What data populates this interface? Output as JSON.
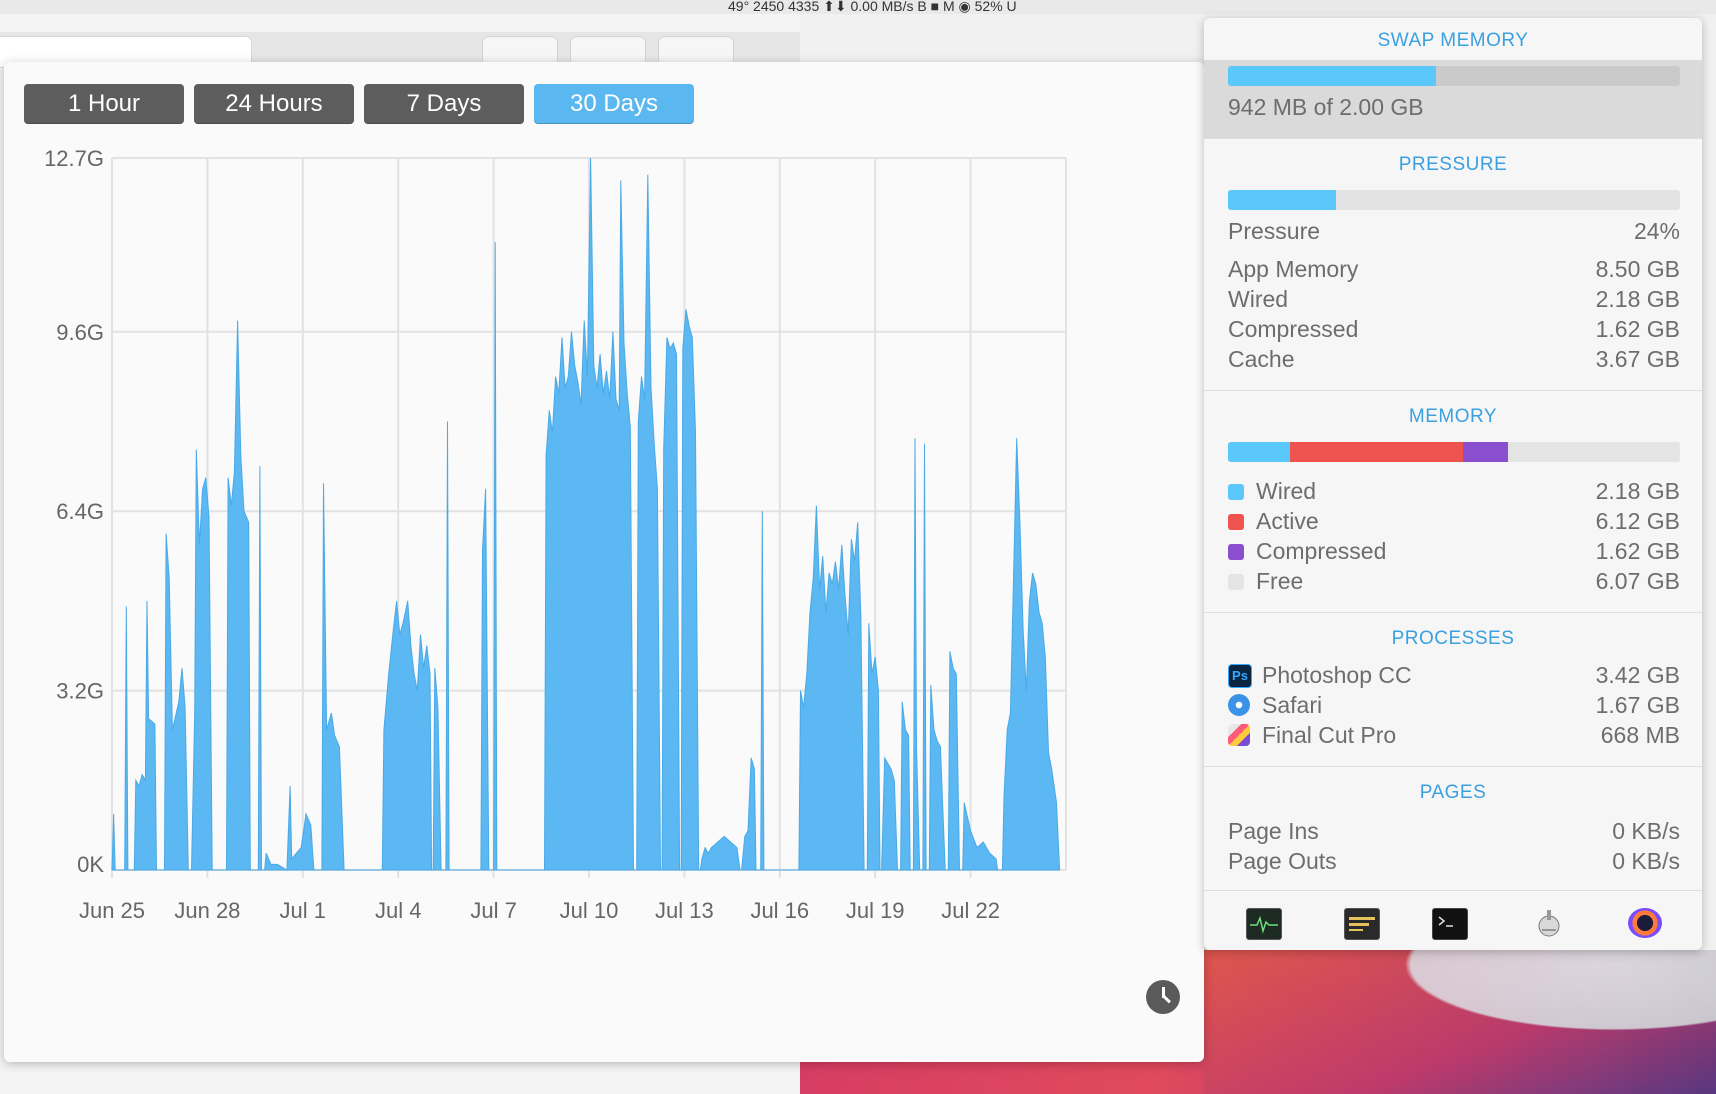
{
  "menubar": {
    "text": "49° 2450 4335 ⬆⬇ 0.00 MB/s B ■ M ◉ 52% U"
  },
  "range_buttons": [
    {
      "label": "1 Hour",
      "active": false
    },
    {
      "label": "24 Hours",
      "active": false
    },
    {
      "label": "7 Days",
      "active": false
    },
    {
      "label": "30 Days",
      "active": true
    }
  ],
  "chart_data": {
    "type": "area",
    "x_tick_labels": [
      "Jun 25",
      "Jun 28",
      "Jul 1",
      "Jul 4",
      "Jul 7",
      "Jul 10",
      "Jul 13",
      "Jul 16",
      "Jul 19",
      "Jul 22"
    ],
    "y_tick_labels": [
      "12.7G",
      "9.6G",
      "6.4G",
      "3.2G",
      "0K"
    ],
    "y_tick_values": [
      12.7,
      9.6,
      6.4,
      3.2,
      0
    ],
    "ylim": [
      0,
      12.7
    ],
    "x_unit": "days since Jun 25",
    "xlim": [
      0,
      30
    ],
    "grid": true,
    "color": "#5bb8f2",
    "series": [
      {
        "values": [
          [
            0.0,
            0
          ],
          [
            0.05,
            1.0
          ],
          [
            0.1,
            0
          ],
          [
            0.4,
            0
          ],
          [
            0.45,
            4.7
          ],
          [
            0.5,
            0
          ],
          [
            0.7,
            0
          ],
          [
            0.75,
            1.6
          ],
          [
            0.85,
            1.5
          ],
          [
            0.95,
            1.7
          ],
          [
            1.05,
            1.6
          ],
          [
            1.1,
            4.8
          ],
          [
            1.15,
            2.7
          ],
          [
            1.35,
            2.6
          ],
          [
            1.4,
            0
          ],
          [
            1.65,
            0
          ],
          [
            1.7,
            6.0
          ],
          [
            1.8,
            5.2
          ],
          [
            1.9,
            2.5
          ],
          [
            2.1,
            3.0
          ],
          [
            2.2,
            3.6
          ],
          [
            2.3,
            2.9
          ],
          [
            2.4,
            0
          ],
          [
            2.5,
            0
          ],
          [
            2.6,
            2.8
          ],
          [
            2.65,
            7.5
          ],
          [
            2.75,
            5.8
          ],
          [
            2.85,
            6.8
          ],
          [
            2.95,
            7.0
          ],
          [
            3.05,
            6.3
          ],
          [
            3.15,
            0
          ],
          [
            3.6,
            0
          ],
          [
            3.65,
            7.0
          ],
          [
            3.75,
            6.5
          ],
          [
            3.85,
            7.1
          ],
          [
            3.95,
            9.8
          ],
          [
            4.05,
            7.4
          ],
          [
            4.15,
            6.4
          ],
          [
            4.3,
            6.2
          ],
          [
            4.35,
            0
          ],
          [
            4.6,
            0
          ],
          [
            4.65,
            7.2
          ],
          [
            4.7,
            0
          ],
          [
            4.8,
            0
          ],
          [
            4.85,
            0.3
          ],
          [
            5.0,
            0.1
          ],
          [
            5.2,
            0.1
          ],
          [
            5.5,
            0
          ],
          [
            5.6,
            1.5
          ],
          [
            5.65,
            0.2
          ],
          [
            5.8,
            0.3
          ],
          [
            5.95,
            0.4
          ],
          [
            6.1,
            1.0
          ],
          [
            6.25,
            0.8
          ],
          [
            6.35,
            0
          ],
          [
            6.6,
            0
          ],
          [
            6.65,
            6.9
          ],
          [
            6.75,
            2.5
          ],
          [
            6.9,
            2.8
          ],
          [
            7.0,
            2.4
          ],
          [
            7.15,
            2.2
          ],
          [
            7.3,
            0
          ],
          [
            8.5,
            0
          ],
          [
            8.55,
            2.5
          ],
          [
            8.7,
            3.5
          ],
          [
            8.85,
            4.3
          ],
          [
            8.95,
            4.8
          ],
          [
            9.05,
            4.2
          ],
          [
            9.15,
            4.4
          ],
          [
            9.3,
            4.8
          ],
          [
            9.4,
            4.0
          ],
          [
            9.5,
            3.5
          ],
          [
            9.6,
            3.2
          ],
          [
            9.7,
            4.2
          ],
          [
            9.8,
            3.6
          ],
          [
            9.9,
            4.0
          ],
          [
            10.0,
            3.5
          ],
          [
            10.05,
            0
          ],
          [
            10.1,
            0
          ],
          [
            10.15,
            3.6
          ],
          [
            10.25,
            2.9
          ],
          [
            10.35,
            0
          ],
          [
            10.5,
            0
          ],
          [
            10.55,
            8.0
          ],
          [
            10.6,
            0
          ],
          [
            11.6,
            0
          ],
          [
            11.65,
            5.7
          ],
          [
            11.75,
            6.8
          ],
          [
            11.85,
            0
          ],
          [
            12.0,
            0
          ],
          [
            12.05,
            11.2
          ],
          [
            12.1,
            0
          ],
          [
            13.6,
            0
          ],
          [
            13.65,
            7.4
          ],
          [
            13.75,
            8.2
          ],
          [
            13.85,
            7.8
          ],
          [
            13.95,
            8.8
          ],
          [
            14.05,
            8.5
          ],
          [
            14.15,
            9.5
          ],
          [
            14.25,
            8.6
          ],
          [
            14.35,
            8.8
          ],
          [
            14.45,
            9.6
          ],
          [
            14.55,
            9.0
          ],
          [
            14.65,
            8.7
          ],
          [
            14.75,
            8.3
          ],
          [
            14.85,
            9.8
          ],
          [
            14.95,
            8.8
          ],
          [
            15.05,
            12.7
          ],
          [
            15.15,
            9.0
          ],
          [
            15.25,
            8.6
          ],
          [
            15.35,
            9.2
          ],
          [
            15.45,
            8.5
          ],
          [
            15.55,
            8.9
          ],
          [
            15.65,
            8.4
          ],
          [
            15.75,
            9.6
          ],
          [
            15.85,
            8.4
          ],
          [
            15.95,
            8.2
          ],
          [
            16.0,
            12.3
          ],
          [
            16.1,
            9.4
          ],
          [
            16.2,
            8.5
          ],
          [
            16.3,
            7.9
          ],
          [
            16.4,
            0
          ],
          [
            16.5,
            0
          ],
          [
            16.55,
            8.0
          ],
          [
            16.65,
            8.8
          ],
          [
            16.75,
            8.4
          ],
          [
            16.85,
            12.4
          ],
          [
            16.95,
            8.6
          ],
          [
            17.05,
            7.6
          ],
          [
            17.15,
            6.8
          ],
          [
            17.25,
            0
          ],
          [
            17.3,
            0
          ],
          [
            17.35,
            7.5
          ],
          [
            17.45,
            9.5
          ],
          [
            17.55,
            9.3
          ],
          [
            17.65,
            9.4
          ],
          [
            17.75,
            9.2
          ],
          [
            17.85,
            0
          ],
          [
            17.9,
            0
          ],
          [
            17.95,
            9.3
          ],
          [
            18.05,
            10.0
          ],
          [
            18.15,
            9.7
          ],
          [
            18.25,
            9.5
          ],
          [
            18.35,
            7.8
          ],
          [
            18.45,
            0
          ],
          [
            18.5,
            0
          ],
          [
            18.55,
            0.2
          ],
          [
            18.65,
            0.4
          ],
          [
            18.75,
            0.3
          ],
          [
            18.85,
            0.4
          ],
          [
            19.05,
            0.5
          ],
          [
            19.25,
            0.6
          ],
          [
            19.45,
            0.5
          ],
          [
            19.65,
            0.4
          ],
          [
            19.75,
            0
          ],
          [
            19.8,
            0
          ],
          [
            19.9,
            0.6
          ],
          [
            20.0,
            0.7
          ],
          [
            20.1,
            2.0
          ],
          [
            20.2,
            1.8
          ],
          [
            20.25,
            0
          ],
          [
            20.4,
            0
          ],
          [
            20.45,
            6.4
          ],
          [
            20.5,
            0
          ],
          [
            21.6,
            0
          ],
          [
            21.65,
            3.2
          ],
          [
            21.75,
            2.9
          ],
          [
            21.85,
            3.5
          ],
          [
            21.95,
            4.6
          ],
          [
            22.05,
            5.2
          ],
          [
            22.15,
            6.5
          ],
          [
            22.25,
            5.0
          ],
          [
            22.35,
            5.6
          ],
          [
            22.45,
            4.6
          ],
          [
            22.55,
            5.3
          ],
          [
            22.65,
            5.1
          ],
          [
            22.75,
            5.5
          ],
          [
            22.85,
            5.0
          ],
          [
            22.95,
            5.8
          ],
          [
            23.05,
            4.9
          ],
          [
            23.15,
            4.2
          ],
          [
            23.25,
            5.9
          ],
          [
            23.35,
            5.5
          ],
          [
            23.45,
            6.2
          ],
          [
            23.55,
            4.5
          ],
          [
            23.65,
            0
          ],
          [
            23.75,
            0
          ],
          [
            23.8,
            4.4
          ],
          [
            23.9,
            3.5
          ],
          [
            24.0,
            3.8
          ],
          [
            24.1,
            3.2
          ],
          [
            24.15,
            0
          ],
          [
            24.2,
            0
          ],
          [
            24.3,
            2.0
          ],
          [
            24.4,
            1.9
          ],
          [
            24.5,
            1.8
          ],
          [
            24.6,
            1.6
          ],
          [
            24.7,
            0
          ],
          [
            24.8,
            0
          ],
          [
            24.85,
            3.0
          ],
          [
            24.95,
            2.5
          ],
          [
            25.05,
            2.4
          ],
          [
            25.1,
            0
          ],
          [
            25.2,
            0
          ],
          [
            25.25,
            7.7
          ],
          [
            25.3,
            2.2
          ],
          [
            25.4,
            0
          ],
          [
            25.5,
            0
          ],
          [
            25.55,
            7.6
          ],
          [
            25.6,
            0
          ],
          [
            25.7,
            0
          ],
          [
            25.75,
            3.3
          ],
          [
            25.85,
            2.5
          ],
          [
            25.95,
            2.3
          ],
          [
            26.05,
            2.2
          ],
          [
            26.2,
            0
          ],
          [
            26.3,
            0
          ],
          [
            26.35,
            3.9
          ],
          [
            26.45,
            3.6
          ],
          [
            26.55,
            3.5
          ],
          [
            26.65,
            0
          ],
          [
            26.75,
            0
          ],
          [
            26.8,
            1.2
          ],
          [
            27.0,
            0.7
          ],
          [
            27.2,
            0.4
          ],
          [
            27.4,
            0.5
          ],
          [
            27.6,
            0.3
          ],
          [
            27.8,
            0.2
          ],
          [
            27.85,
            0
          ],
          [
            28.0,
            0
          ],
          [
            28.05,
            1.3
          ],
          [
            28.15,
            2.5
          ],
          [
            28.25,
            2.8
          ],
          [
            28.35,
            5.2
          ],
          [
            28.45,
            7.7
          ],
          [
            28.55,
            6.2
          ],
          [
            28.65,
            4.3
          ],
          [
            28.75,
            3.2
          ],
          [
            28.85,
            4.8
          ],
          [
            28.95,
            5.3
          ],
          [
            29.05,
            5.1
          ],
          [
            29.15,
            4.6
          ],
          [
            29.25,
            4.4
          ],
          [
            29.35,
            3.8
          ],
          [
            29.45,
            2.1
          ],
          [
            29.55,
            1.8
          ],
          [
            29.6,
            1.6
          ],
          [
            29.7,
            1.2
          ],
          [
            29.8,
            0
          ]
        ]
      }
    ]
  },
  "stats": {
    "swap": {
      "title": "SWAP MEMORY",
      "caption": "942 MB of 2.00 GB",
      "fraction": 0.46
    },
    "pressure": {
      "title": "PRESSURE",
      "fraction": 0.24,
      "rows": [
        {
          "label": "Pressure",
          "value": "24%"
        },
        {
          "label": "App Memory",
          "value": "8.50 GB"
        },
        {
          "label": "Wired",
          "value": "2.18 GB"
        },
        {
          "label": "Compressed",
          "value": "1.62 GB"
        },
        {
          "label": "Cache",
          "value": "3.67 GB"
        }
      ]
    },
    "memory": {
      "title": "MEMORY",
      "segments": [
        {
          "label": "Wired",
          "value": "2.18 GB",
          "gb": 2.18,
          "color": "#5ac8fa"
        },
        {
          "label": "Active",
          "value": "6.12 GB",
          "gb": 6.12,
          "color": "#ef5350"
        },
        {
          "label": "Compressed",
          "value": "1.62 GB",
          "gb": 1.62,
          "color": "#8a4fcf"
        },
        {
          "label": "Free",
          "value": "6.07 GB",
          "gb": 6.07,
          "color": "#e4e4e4"
        }
      ]
    },
    "processes": {
      "title": "PROCESSES",
      "rows": [
        {
          "label": "Photoshop CC",
          "value": "3.42 GB",
          "icon": "photoshop-icon"
        },
        {
          "label": "Safari",
          "value": "1.67 GB",
          "icon": "safari-icon"
        },
        {
          "label": "Final Cut Pro",
          "value": "668 MB",
          "icon": "final-cut-pro-icon"
        }
      ]
    },
    "pages": {
      "title": "PAGES",
      "rows": [
        {
          "label": "Page Ins",
          "value": "0 KB/s"
        },
        {
          "label": "Page Outs",
          "value": "0 KB/s"
        }
      ]
    },
    "toolbar": [
      {
        "icon": "activity-monitor-icon"
      },
      {
        "icon": "console-icon"
      },
      {
        "icon": "terminal-icon"
      },
      {
        "icon": "disk-utility-icon"
      },
      {
        "icon": "istat-menus-icon"
      }
    ]
  }
}
